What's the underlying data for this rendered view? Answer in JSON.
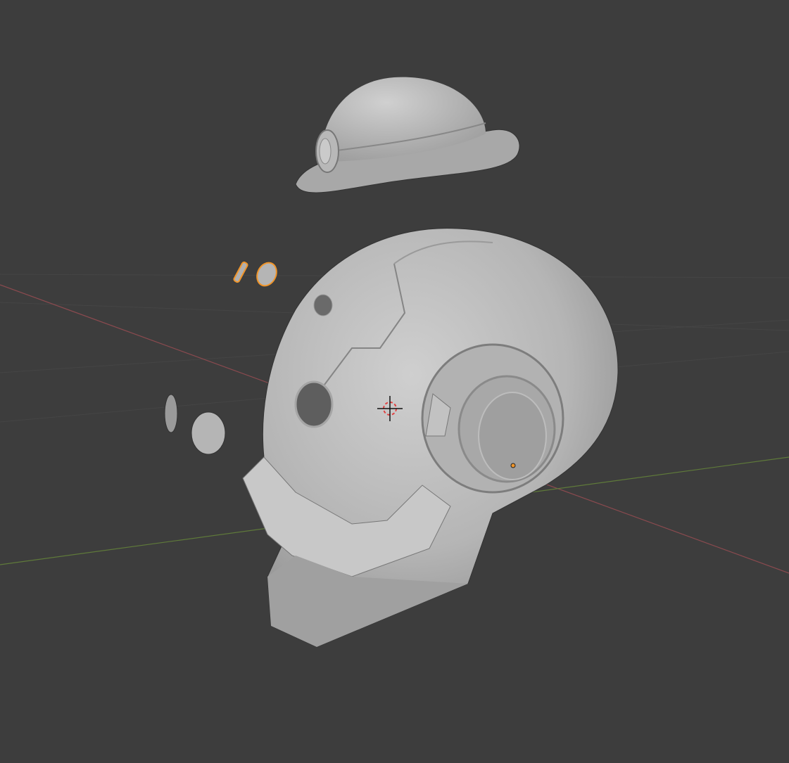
{
  "viewport": {
    "background": "#3d3d3d",
    "grid_color": "#474747",
    "x_axis_color": "#8a4a4f",
    "y_axis_color": "#5f7a3a",
    "selection_outline": "#f0952a",
    "mesh_light": "#c4c4c4",
    "mesh_mid": "#a6a6a6",
    "mesh_dark": "#7c7c7c"
  },
  "icons": {
    "cursor": "3d-cursor-icon",
    "origin": "object-origin-icon"
  }
}
